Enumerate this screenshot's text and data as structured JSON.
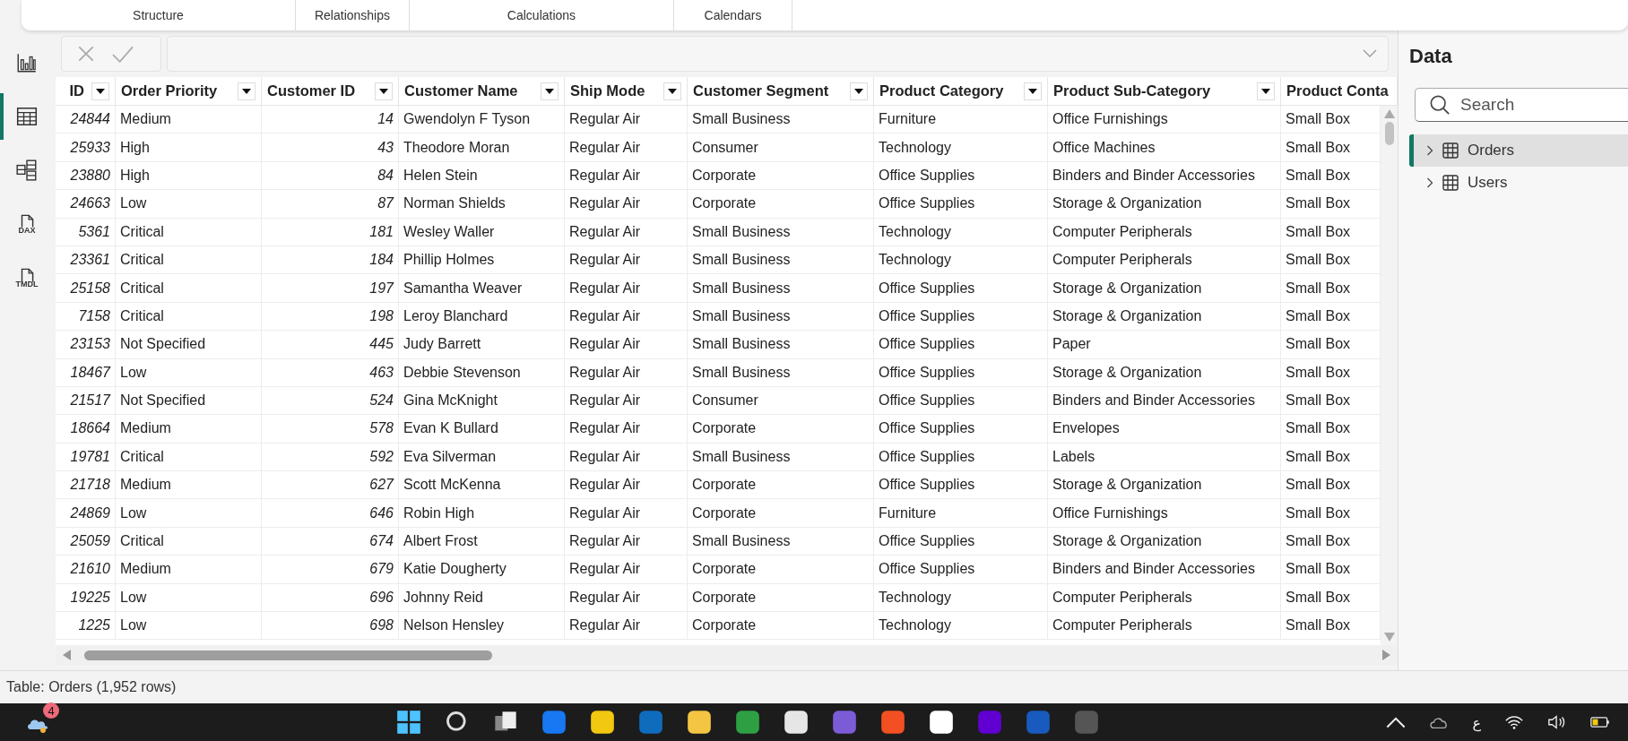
{
  "ribbon_tabs": [
    {
      "label": "Structure"
    },
    {
      "label": "Relationships"
    },
    {
      "label": "Calculations"
    },
    {
      "label": "Calendars"
    }
  ],
  "rail": [
    {
      "kind": "report",
      "selected": false
    },
    {
      "kind": "table",
      "selected": true
    },
    {
      "kind": "model",
      "selected": false
    },
    {
      "kind": "dax",
      "label": "DAX",
      "selected": false
    },
    {
      "kind": "tmdl",
      "label": "TMDL",
      "selected": false
    }
  ],
  "formula_bar": {
    "disabled": true
  },
  "table": {
    "columns": [
      {
        "label": "ID",
        "kind": "number"
      },
      {
        "label": "Order Priority",
        "kind": "text"
      },
      {
        "label": "Customer ID",
        "kind": "number"
      },
      {
        "label": "Customer Name",
        "kind": "text"
      },
      {
        "label": "Ship Mode",
        "kind": "text"
      },
      {
        "label": "Customer Segment",
        "kind": "text"
      },
      {
        "label": "Product Category",
        "kind": "text"
      },
      {
        "label": "Product Sub-Category",
        "kind": "text"
      },
      {
        "label": "Product Conta",
        "kind": "text"
      }
    ],
    "rows": [
      [
        "24844",
        "Medium",
        "14",
        "Gwendolyn F Tyson",
        "Regular Air",
        "Small Business",
        "Furniture",
        "Office Furnishings",
        "Small Box"
      ],
      [
        "25933",
        "High",
        "43",
        "Theodore Moran",
        "Regular Air",
        "Consumer",
        "Technology",
        "Office Machines",
        "Small Box"
      ],
      [
        "23880",
        "High",
        "84",
        "Helen Stein",
        "Regular Air",
        "Corporate",
        "Office Supplies",
        "Binders and Binder Accessories",
        "Small Box"
      ],
      [
        "24663",
        "Low",
        "87",
        "Norman Shields",
        "Regular Air",
        "Corporate",
        "Office Supplies",
        "Storage & Organization",
        "Small Box"
      ],
      [
        "5361",
        "Critical",
        "181",
        "Wesley Waller",
        "Regular Air",
        "Small Business",
        "Technology",
        "Computer Peripherals",
        "Small Box"
      ],
      [
        "23361",
        "Critical",
        "184",
        "Phillip Holmes",
        "Regular Air",
        "Small Business",
        "Technology",
        "Computer Peripherals",
        "Small Box"
      ],
      [
        "25158",
        "Critical",
        "197",
        "Samantha Weaver",
        "Regular Air",
        "Small Business",
        "Office Supplies",
        "Storage & Organization",
        "Small Box"
      ],
      [
        "7158",
        "Critical",
        "198",
        "Leroy Blanchard",
        "Regular Air",
        "Small Business",
        "Office Supplies",
        "Storage & Organization",
        "Small Box"
      ],
      [
        "23153",
        "Not Specified",
        "445",
        "Judy Barrett",
        "Regular Air",
        "Small Business",
        "Office Supplies",
        "Paper",
        "Small Box"
      ],
      [
        "18467",
        "Low",
        "463",
        "Debbie Stevenson",
        "Regular Air",
        "Small Business",
        "Office Supplies",
        "Storage & Organization",
        "Small Box"
      ],
      [
        "21517",
        "Not Specified",
        "524",
        "Gina McKnight",
        "Regular Air",
        "Consumer",
        "Office Supplies",
        "Binders and Binder Accessories",
        "Small Box"
      ],
      [
        "18664",
        "Medium",
        "578",
        "Evan K Bullard",
        "Regular Air",
        "Corporate",
        "Office Supplies",
        "Envelopes",
        "Small Box"
      ],
      [
        "19781",
        "Critical",
        "592",
        "Eva Silverman",
        "Regular Air",
        "Small Business",
        "Office Supplies",
        "Labels",
        "Small Box"
      ],
      [
        "21718",
        "Medium",
        "627",
        "Scott McKenna",
        "Regular Air",
        "Corporate",
        "Office Supplies",
        "Storage & Organization",
        "Small Box"
      ],
      [
        "24869",
        "Low",
        "646",
        "Robin High",
        "Regular Air",
        "Corporate",
        "Furniture",
        "Office Furnishings",
        "Small Box"
      ],
      [
        "25059",
        "Critical",
        "674",
        "Albert Frost",
        "Regular Air",
        "Small Business",
        "Office Supplies",
        "Storage & Organization",
        "Small Box"
      ],
      [
        "21610",
        "Medium",
        "679",
        "Katie Dougherty",
        "Regular Air",
        "Corporate",
        "Office Supplies",
        "Binders and Binder Accessories",
        "Small Box"
      ],
      [
        "19225",
        "Low",
        "696",
        "Johnny Reid",
        "Regular Air",
        "Corporate",
        "Technology",
        "Computer Peripherals",
        "Small Box"
      ],
      [
        "1225",
        "Low",
        "698",
        "Nelson Hensley",
        "Regular Air",
        "Corporate",
        "Technology",
        "Computer Peripherals",
        "Small Box"
      ]
    ]
  },
  "data_pane": {
    "title": "Data",
    "search": {
      "placeholder": "Search"
    },
    "tables": [
      {
        "label": "Orders",
        "selected": true
      },
      {
        "label": "Users",
        "selected": false
      }
    ]
  },
  "status_bar": "Table: Orders (1,952 rows)",
  "taskbar": {
    "weather_badge": "4",
    "apps": [
      {
        "kind": "start"
      },
      {
        "kind": "search"
      },
      {
        "kind": "taskview"
      },
      {
        "kind": "app",
        "color": "#1877f2"
      },
      {
        "kind": "app",
        "color": "#f2c811"
      },
      {
        "kind": "app",
        "color": "#0f6cbd"
      },
      {
        "kind": "app",
        "color": "#f4c542"
      },
      {
        "kind": "app",
        "color": "#2ea043"
      },
      {
        "kind": "app",
        "color": "#e6e6e6"
      },
      {
        "kind": "app",
        "color": "#7b5cd6"
      },
      {
        "kind": "app",
        "color": "#f25022"
      },
      {
        "kind": "app",
        "color": "#ffffff"
      },
      {
        "kind": "app",
        "color": "#6001d2"
      },
      {
        "kind": "app",
        "color": "#185abd"
      },
      {
        "kind": "app",
        "color": "#555555"
      }
    ],
    "language": "ع"
  }
}
